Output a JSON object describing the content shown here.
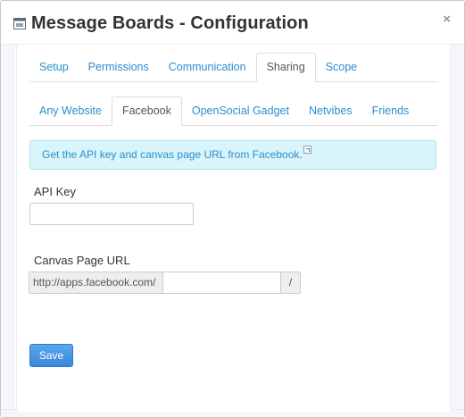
{
  "dialog": {
    "title": "Message Boards - Configuration",
    "close_glyph": "×",
    "icon": "window-icon"
  },
  "tabs": [
    {
      "label": "Setup",
      "active": false
    },
    {
      "label": "Permissions",
      "active": false
    },
    {
      "label": "Communication",
      "active": false
    },
    {
      "label": "Sharing",
      "active": true
    },
    {
      "label": "Scope",
      "active": false
    }
  ],
  "subtabs": [
    {
      "label": "Any Website",
      "active": false
    },
    {
      "label": "Facebook",
      "active": true
    },
    {
      "label": "OpenSocial Gadget",
      "active": false
    },
    {
      "label": "Netvibes",
      "active": false
    },
    {
      "label": "Friends",
      "active": false
    }
  ],
  "info": {
    "text": "Get the API key and canvas page URL from Facebook.",
    "icon": "external-link-icon"
  },
  "form": {
    "api_key_label": "API Key",
    "api_key_value": "",
    "canvas_label": "Canvas Page URL",
    "canvas_prefix": "http://apps.facebook.com/",
    "canvas_value": "",
    "canvas_suffix": "/",
    "save_label": "Save"
  },
  "colors": {
    "link": "#2a8fce",
    "info_bg": "#d9f4fa",
    "info_border": "#aee0ee",
    "primary_button": "#3a86d8"
  }
}
